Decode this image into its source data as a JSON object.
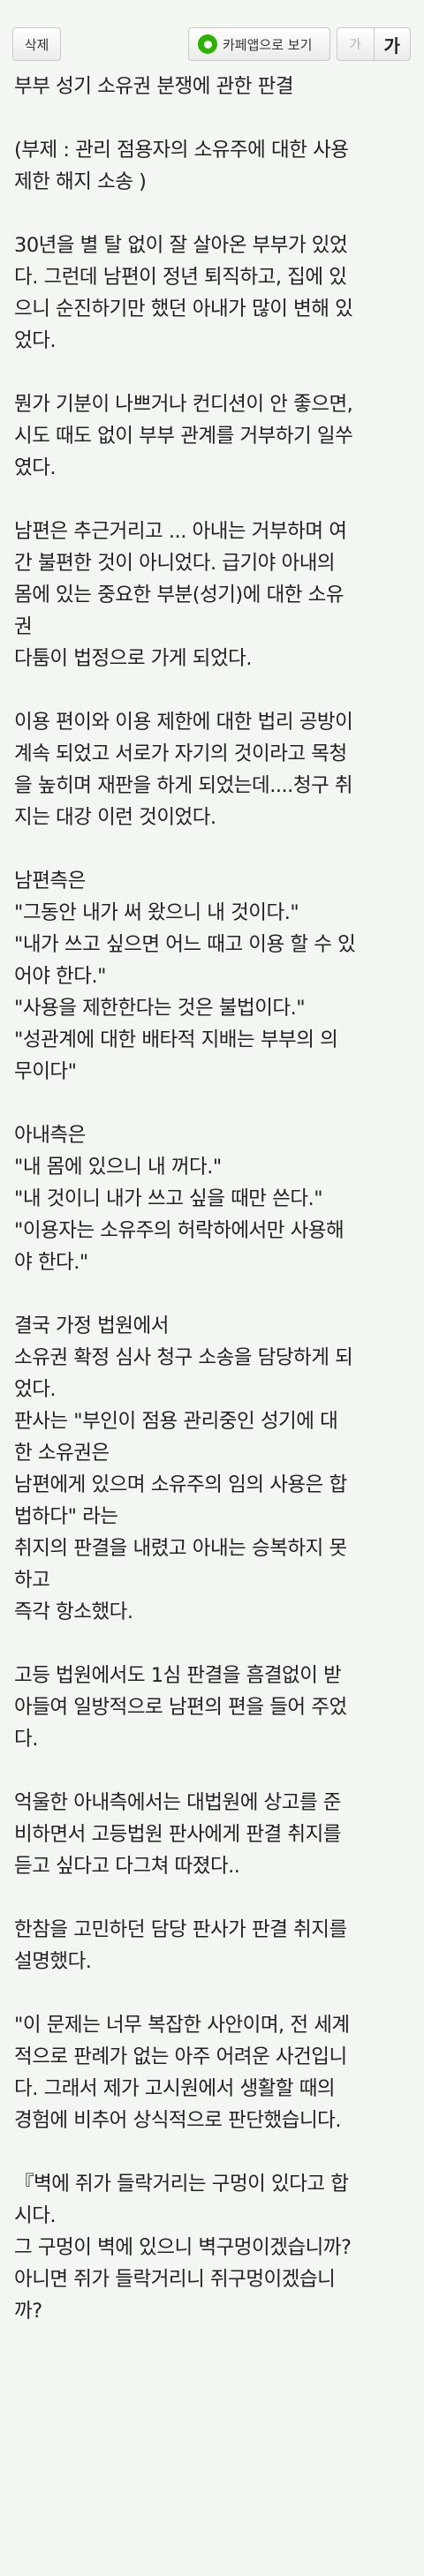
{
  "toolbar": {
    "delete_label": "삭제",
    "cafe_app_label": "카페앱으로 보기",
    "font_small_label": "가",
    "font_large_label": "가"
  },
  "article": {
    "lines": [
      "부부 성기 소유권 분쟁에 관한 판결",
      "",
      "(부제 : 관리 점용자의 소유주에 대한 사용",
      "제한 해지 소송 )",
      "",
      "30년을 별 탈 없이 잘 살아온 부부가 있었",
      "다. 그런데 남편이 정년 퇴직하고, 집에 있",
      "으니 순진하기만 했던 아내가 많이 변해 있",
      "었다.",
      "",
      "뭔가 기분이 나쁘거나 컨디션이 안 좋으면,",
      "시도 때도 없이 부부 관계를 거부하기 일쑤",
      "였다.",
      "",
      "남편은 추근거리고 ... 아내는 거부하며 여",
      "간 불편한 것이 아니었다. 급기야 아내의",
      "몸에 있는 중요한 부분(성기)에 대한 소유",
      "권",
      "다툼이 법정으로 가게 되었다.",
      "",
      "이용 편이와 이용 제한에 대한 법리 공방이",
      "계속 되었고 서로가 자기의 것이라고 목청",
      "을 높히며 재판을 하게 되었는데....청구 취",
      "지는 대강 이런 것이었다.",
      "",
      "남편측은",
      "\"그동안 내가 써 왔으니 내 것이다.\"",
      "\"내가 쓰고 싶으면 어느 때고 이용 할 수 있",
      "어야 한다.\"",
      "\"사용을 제한한다는 것은 불법이다.\"",
      "\"성관계에 대한 배타적 지배는 부부의 의",
      "무이다\"",
      "",
      "아내측은",
      "\"내 몸에 있으니 내 꺼다.\"",
      "\"내 것이니 내가 쓰고 싶을 때만 쓴다.\"",
      "\"이용자는 소유주의 허락하에서만 사용해",
      "야 한다.\"",
      "",
      "결국 가정 법원에서",
      "소유권 확정 심사 청구 소송을 담당하게 되",
      "었다.",
      "판사는 \"부인이 점용 관리중인 성기에 대",
      "한 소유권은",
      "남편에게 있으며 소유주의 임의 사용은 합",
      "법하다\" 라는",
      "취지의 판결을 내렸고 아내는 승복하지 못",
      "하고",
      "즉각 항소했다.",
      "",
      "고등 법원에서도 1심 판결을 흠결없이 받",
      "아들여 일방적으로 남편의 편을 들어 주었",
      "다.",
      "",
      "억울한 아내측에서는 대법원에 상고를 준",
      "비하면서 고등법원 판사에게 판결 취지를",
      "듣고 싶다고 다그쳐 따졌다..",
      "",
      "한참을 고민하던 담당 판사가 판결 취지를",
      "설명했다.",
      "",
      "\"이 문제는 너무 복잡한 사안이며, 전 세계",
      "적으로 판례가 없는 아주 어려운 사건입니",
      "다. 그래서 제가 고시원에서 생활할 때의",
      "경험에 비추어 상식적으로 판단했습니다.",
      "",
      "『벽에 쥐가 들락거리는 구멍이 있다고 합",
      "시다.",
      "그 구멍이 벽에 있으니 벽구멍이겠습니까?",
      "아니면 쥐가 들락거리니 쥐구멍이겠습니",
      "까?"
    ]
  }
}
